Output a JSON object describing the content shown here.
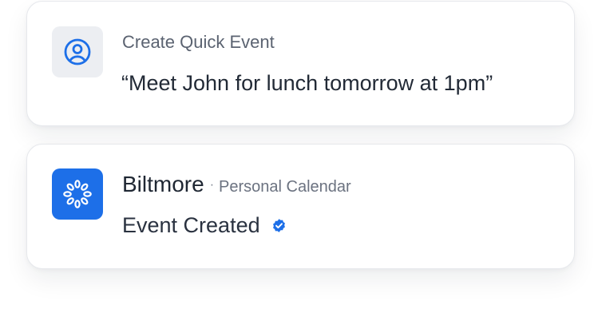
{
  "quick_event": {
    "title": "Create Quick Event",
    "query": "“Meet John for lunch tomorrow at 1pm”",
    "icon": "user-circle-icon"
  },
  "event_result": {
    "app_name": "Biltmore",
    "separator": "·",
    "calendar": "Personal Calendar",
    "status": "Event Created",
    "icon": "biltmore-logo-icon",
    "status_icon": "verified-check-icon",
    "accent": "#1d6fe8"
  }
}
